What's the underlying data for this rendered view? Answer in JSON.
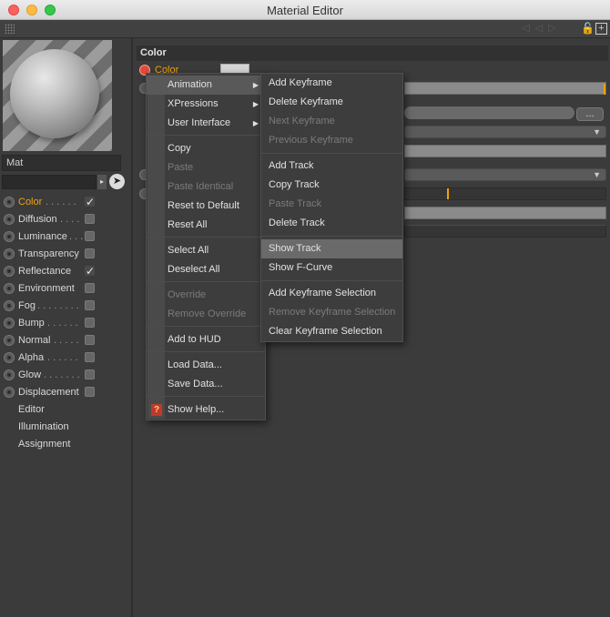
{
  "window": {
    "title": "Material Editor"
  },
  "material": {
    "name": "Mat"
  },
  "channels": [
    {
      "label": "Color",
      "dots": ". . . . . .",
      "checked": true,
      "active": true
    },
    {
      "label": "Diffusion",
      "dots": ". . . .",
      "checked": false
    },
    {
      "label": "Luminance",
      "dots": ". . .",
      "checked": false
    },
    {
      "label": "Transparency",
      "dots": "",
      "checked": false
    },
    {
      "label": "Reflectance",
      "dots": "",
      "checked": true
    },
    {
      "label": "Environment",
      "dots": "",
      "checked": false
    },
    {
      "label": "Fog",
      "dots": ". . . . . . . .",
      "checked": false
    },
    {
      "label": "Bump",
      "dots": ". . . . . .",
      "checked": false
    },
    {
      "label": "Normal",
      "dots": ". . . . .",
      "checked": false
    },
    {
      "label": "Alpha",
      "dots": ". . . . . .",
      "checked": false
    },
    {
      "label": "Glow",
      "dots": ". . . . . . .",
      "checked": false
    },
    {
      "label": "Displacement",
      "dots": "",
      "checked": false
    }
  ],
  "extra_items": [
    "Editor",
    "Illumination",
    "Assignment"
  ],
  "section": {
    "title": "Color",
    "prop_label": "Color"
  },
  "context_menu": {
    "items": [
      {
        "label": "Animation",
        "submenu": true,
        "disabled": false,
        "hover": true
      },
      {
        "label": "XPressions",
        "submenu": true,
        "disabled": false
      },
      {
        "label": "User Interface",
        "submenu": true,
        "disabled": false
      },
      {
        "label": "Copy",
        "disabled": false
      },
      {
        "label": "Paste",
        "disabled": true
      },
      {
        "label": "Paste Identical",
        "disabled": true
      },
      {
        "label": "Reset to Default",
        "disabled": false
      },
      {
        "label": "Reset All",
        "disabled": false
      },
      {
        "label": "Select All",
        "disabled": false
      },
      {
        "label": "Deselect All",
        "disabled": false
      },
      {
        "label": "Override",
        "disabled": true
      },
      {
        "label": "Remove Override",
        "disabled": true
      },
      {
        "label": "Add to HUD",
        "disabled": false
      },
      {
        "label": "Load Data...",
        "disabled": false
      },
      {
        "label": "Save Data...",
        "disabled": false
      },
      {
        "label": "Show Help...",
        "disabled": false
      }
    ]
  },
  "animation_submenu": {
    "items": [
      {
        "label": "Add Keyframe",
        "disabled": false
      },
      {
        "label": "Delete Keyframe",
        "disabled": false
      },
      {
        "label": "Next Keyframe",
        "disabled": true
      },
      {
        "label": "Previous Keyframe",
        "disabled": true
      },
      {
        "label": "Add Track",
        "disabled": false
      },
      {
        "label": "Copy Track",
        "disabled": false
      },
      {
        "label": "Paste Track",
        "disabled": true
      },
      {
        "label": "Delete Track",
        "disabled": false
      },
      {
        "label": "Show Track",
        "disabled": false,
        "hover": true
      },
      {
        "label": "Show F-Curve",
        "disabled": false
      },
      {
        "label": "Add Keyframe Selection",
        "disabled": false
      },
      {
        "label": "Remove Keyframe Selection",
        "disabled": true
      },
      {
        "label": "Clear Keyframe Selection",
        "disabled": false
      }
    ]
  },
  "buttons": {
    "ellipsis": "..."
  },
  "icons": {
    "picker": "pointer-icon",
    "help": "help-icon",
    "lock": "lock-icon",
    "add": "add-icon"
  },
  "colors": {
    "accent": "#f2a20a",
    "panel": "#3b3b3b"
  }
}
